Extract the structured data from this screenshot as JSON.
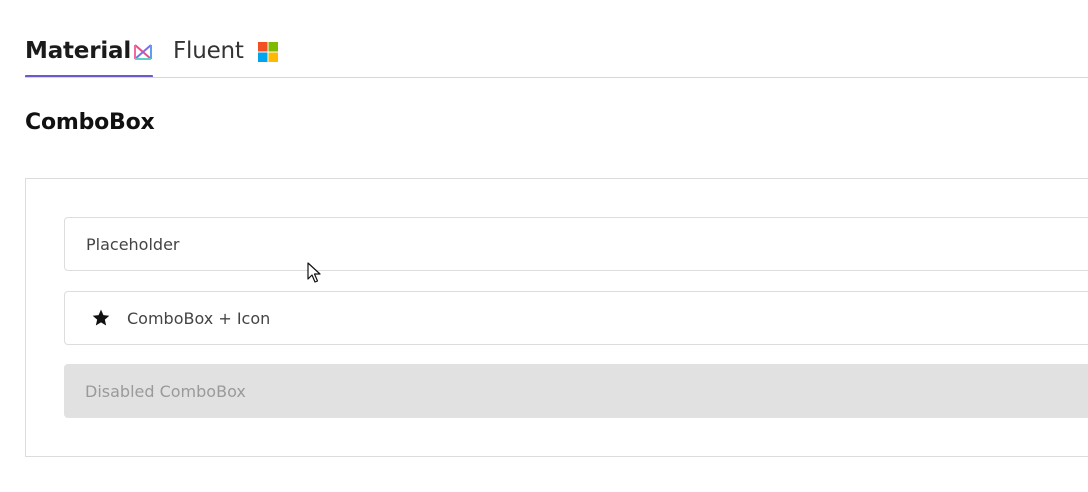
{
  "tabs": [
    {
      "label": "Material",
      "active": true,
      "icon": "material-logo-icon"
    },
    {
      "label": "Fluent",
      "active": false,
      "icon": "windows-logo-icon"
    }
  ],
  "section": {
    "title": "ComboBox"
  },
  "combos": {
    "placeholder": "Placeholder",
    "with_icon": "ComboBox + Icon",
    "with_icon_icon": "star-icon",
    "disabled": "Disabled ComboBox"
  },
  "colors": {
    "accent": "#6a5acd",
    "border": "#dddddd",
    "disabled_bg": "#e1e1e1",
    "disabled_text": "#9a9a9a",
    "windows_red": "#f25022",
    "windows_green": "#7fba00",
    "windows_blue": "#00a4ef",
    "windows_yellow": "#ffb900"
  }
}
